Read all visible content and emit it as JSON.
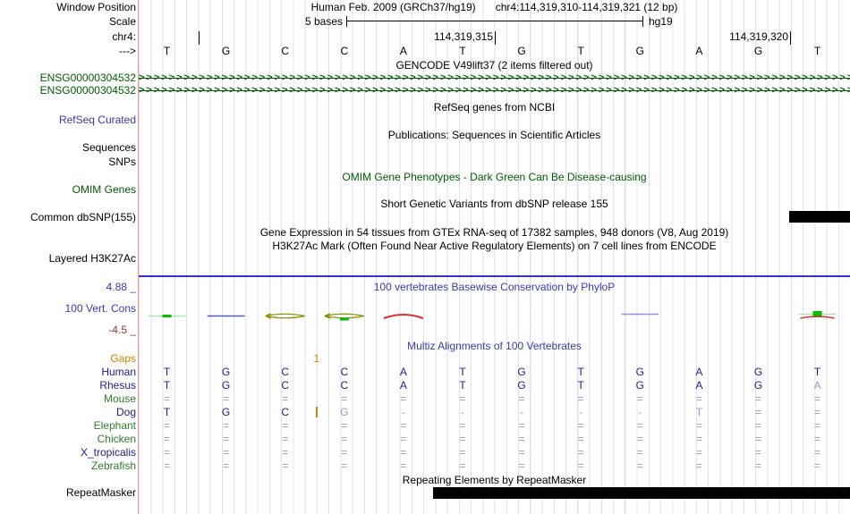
{
  "header": {
    "window_position_label": "Window Position",
    "assembly_text": "Human Feb. 2009 (GRCh37/hg19)",
    "position_text": "chr4:114,319,310-114,319,321 (12 bp)",
    "scale_label": "Scale",
    "scale_text": "5 bases",
    "assembly_short": "hg19",
    "chrom_label": "chr4:",
    "coord_labels": [
      "114,319,315",
      "114,319,320"
    ],
    "strand_label": "--->",
    "bases": [
      "T",
      "G",
      "C",
      "C",
      "A",
      "T",
      "G",
      "T",
      "G",
      "A",
      "G",
      "T"
    ]
  },
  "tracks": {
    "gencode": {
      "title": "GENCODE V49lift37 (2 items filtered out)",
      "genes": [
        "ENSG00000304532",
        "ENSG00000304532"
      ]
    },
    "refseq": {
      "label": "RefSeq Curated",
      "title": "RefSeq genes from NCBI"
    },
    "publications": {
      "title": "Publications: Sequences in Scientific Articles"
    },
    "sequences": {
      "label": "Sequences"
    },
    "snps": {
      "label": "SNPs"
    },
    "omim": {
      "label": "OMIM Genes",
      "title": "OMIM Gene Phenotypes - Dark Green Can Be Disease-causing"
    },
    "dbsnp": {
      "label": "Common dbSNP(155)",
      "title": "Short Genetic Variants from dbSNP release 155"
    },
    "gtex": {
      "title": "Gene Expression in 54 tissues from GTEx RNA-seq of 17382 samples, 948 donors (V8, Aug 2019)"
    },
    "h3k27ac": {
      "label": "Layered H3K27Ac",
      "title": "H3K27Ac Mark (Often Found Near Active Regulatory Elements) on 7 cell lines from ENCODE"
    },
    "conservation": {
      "label": "100 Vert. Cons",
      "title": "100 vertebrates Basewise Conservation by PhyloP",
      "scale_max": "4.88 _",
      "scale_min": "-4.5 _",
      "marks": [
        {
          "base": 1,
          "shape": "hline",
          "color": "#aee8ae"
        },
        {
          "base": 1,
          "shape": "dash",
          "color": "#00c000"
        },
        {
          "base": 2,
          "shape": "hline",
          "color": "#5858dd"
        },
        {
          "base": 3,
          "shape": "lens",
          "color": "#8f8f00"
        },
        {
          "base": 4,
          "shape": "lens",
          "color": "#8f8f00"
        },
        {
          "base": 4,
          "shape": "dash_low",
          "color": "#00c000"
        },
        {
          "base": 5,
          "shape": "arc",
          "color": "#e03030"
        },
        {
          "base": 9,
          "shape": "hline_hi",
          "color": "#9595e2"
        },
        {
          "base": 12,
          "shape": "hline_hi",
          "color": "#aee8ae"
        },
        {
          "base": 12,
          "shape": "square",
          "color": "#00c000"
        },
        {
          "base": 12,
          "shape": "arc_shallow",
          "color": "#e03030"
        }
      ]
    },
    "multiz": {
      "title": "Multiz Alignments of 100 Vertebrates",
      "gaps": {
        "label": "Gaps",
        "value": "1",
        "after_base": 3
      },
      "rows": [
        {
          "label": "Human",
          "color": "navy",
          "cells": [
            "T",
            "G",
            "C",
            "C",
            "A",
            "T",
            "G",
            "T",
            "G",
            "A",
            "G",
            "T"
          ]
        },
        {
          "label": "Rhesus",
          "color": "navy",
          "cells": [
            "T",
            "G",
            "C",
            "C",
            "A",
            "T",
            "G",
            "T",
            "G",
            "A",
            "G",
            "~A"
          ]
        },
        {
          "label": "Mouse",
          "color": "green",
          "cells": [
            "=",
            "=",
            "=",
            "=",
            "=",
            "=",
            "=",
            "=",
            "=",
            "=",
            "=",
            "="
          ]
        },
        {
          "label": "Dog",
          "color": "navy",
          "cells": [
            "T",
            "G",
            "C",
            "~G",
            "-",
            "-",
            "-",
            "-",
            "-",
            "~T",
            "=",
            "="
          ],
          "insert_bar": true
        },
        {
          "label": "Elephant",
          "color": "green",
          "cells": [
            "=",
            "=",
            "=",
            "=",
            "=",
            "=",
            "=",
            "=",
            "=",
            "=",
            "=",
            "="
          ]
        },
        {
          "label": "Chicken",
          "color": "green",
          "cells": [
            "=",
            "=",
            "=",
            "=",
            "=",
            "=",
            "=",
            "=",
            "=",
            "=",
            "=",
            "="
          ]
        },
        {
          "label": "X_tropicalis",
          "color": "navy",
          "cells": [
            "=",
            "=",
            "=",
            "=",
            "=",
            "=",
            "=",
            "=",
            "=",
            "=",
            "=",
            "="
          ]
        },
        {
          "label": "Zebrafish",
          "color": "green",
          "cells": [
            "=",
            "=",
            "=",
            "=",
            "=",
            "=",
            "=",
            "=",
            "=",
            "=",
            "=",
            "="
          ]
        }
      ]
    },
    "repeatmasker": {
      "label": "RepeatMasker",
      "title": "Repeating Elements by RepeatMasker"
    }
  },
  "colors": {
    "grid": "#dfdff0",
    "separator": "#f09999",
    "navy_base": "#21218e",
    "muted_base": "#9a9ad0",
    "gene_green": "#005c00",
    "species_green": "#2e7d2e",
    "track_blue": "#3838b8",
    "gaps_orange": "#cc8400",
    "cons_min_maroon": "#993333",
    "h3k27ac_blue": "#3333cc",
    "item_black": "#000000"
  }
}
